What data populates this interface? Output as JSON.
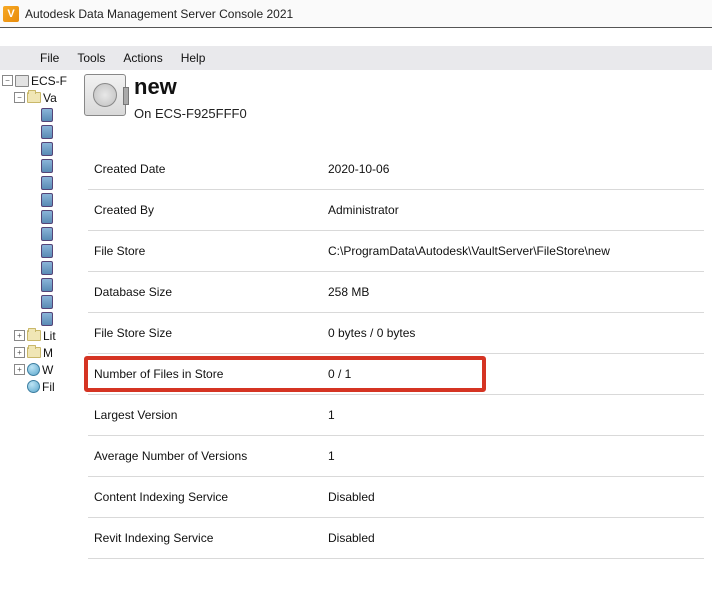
{
  "window": {
    "title": "Autodesk Data Management Server Console 2021",
    "icon": "V"
  },
  "menu": {
    "file": "File",
    "tools": "Tools",
    "actions": "Actions",
    "help": "Help"
  },
  "tree": {
    "root": "ECS-F",
    "sub1": "Va",
    "lib": "Lit",
    "mgmt": "M",
    "wf": "W",
    "fil": "Fil"
  },
  "header": {
    "title": "new",
    "subtitle": "On ECS-F925FFF0"
  },
  "props": [
    {
      "label": "Created Date",
      "value": "2020-10-06",
      "highlight": false
    },
    {
      "label": "Created By",
      "value": "Administrator",
      "highlight": false
    },
    {
      "label": "File Store",
      "value": "C:\\ProgramData\\Autodesk\\VaultServer\\FileStore\\new",
      "highlight": false
    },
    {
      "label": "Database Size",
      "value": "258 MB",
      "highlight": false
    },
    {
      "label": "File Store Size",
      "value": "0 bytes / 0 bytes",
      "highlight": false
    },
    {
      "label": "Number of Files in Store",
      "value": "0 / 1",
      "highlight": true
    },
    {
      "label": "Largest Version",
      "value": "1",
      "highlight": false
    },
    {
      "label": "Average Number of Versions",
      "value": "1",
      "highlight": false
    },
    {
      "label": "Content Indexing Service",
      "value": "Disabled",
      "highlight": false
    },
    {
      "label": "Revit Indexing Service",
      "value": "Disabled",
      "highlight": false
    }
  ]
}
